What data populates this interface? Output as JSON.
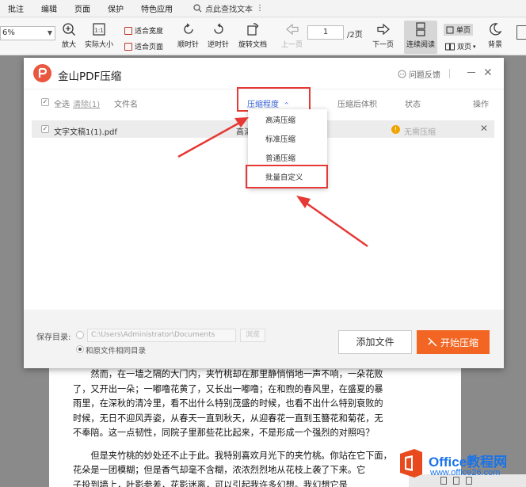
{
  "menubar": {
    "items": [
      "批注",
      "编辑",
      "页面",
      "保护",
      "特色应用"
    ],
    "search_label": "点此查找文本"
  },
  "toolbar": {
    "zoom_value": "6%",
    "zoom_in": "放大",
    "actual_size": "实际大小",
    "fit_width": "适合宽度",
    "fit_page": "适合页面",
    "rotate_cw": "顺时针",
    "rotate_ccw": "逆时针",
    "rotate_doc": "旋转文档",
    "prev_page": "上一页",
    "page_current": "1",
    "page_total": "/2页",
    "next_page": "下一页",
    "continuous": "连续阅读",
    "single": "单页",
    "double": "双页",
    "background": "背景"
  },
  "dialog": {
    "title": "金山PDF压缩",
    "feedback": "问题反馈",
    "columns": {
      "select_all": "全选",
      "clear": "清除(1)",
      "filename": "文件名",
      "level": "压缩程度",
      "after_size": "压缩后体积",
      "status": "状态",
      "action": "操作"
    },
    "file_row": {
      "name": "文字文稿1(1).pdf",
      "level_partial": "高清",
      "status": "无需压缩"
    },
    "dropdown": [
      "高清压缩",
      "标准压缩",
      "普通压缩",
      "批量自定义"
    ],
    "footer": {
      "save_label": "保存目录:",
      "path": "C:\\Users\\Administrator\\Documents",
      "browse": "浏览",
      "same_dir": "和原文件相同目录",
      "add_file": "添加文件",
      "start": "开始压缩"
    }
  },
  "document": {
    "paragraphs": [
      "然而，在一墙之隔的大门内，夹竹桃却在那里静悄悄地一声不响，一朵花败",
      "了，又开出一朵；一嘟噜花黄了，又长出一嘟噜；在和煦的春风里，在盛夏的暴",
      "雨里，在深秋的清冷里，看不出什么特别茂盛的时候，也看不出什么特别衰败的",
      "时候，无日不迎风弄姿，从春天一直到秋天，从迎春花一直到玉簪花和菊花，无",
      "不奉陪。这一点韧性，同院子里那些花比起来，不是形成一个强烈的对照吗？",
      "",
      "但是夹竹桃的妙处还不止于此。我特别喜欢月光下的夹竹桃。你站在它下面，",
      "花朵是一团模糊；但是香气却毫不含糊，浓浓烈烈地从花枝上袭了下来。它",
      "子投到墙上，叶影参差，花影迷离，可以引起我许多幻想。我幻想它是"
    ]
  },
  "watermark": {
    "name": "Office教程网",
    "url": "www.office26.com"
  },
  "colors": {
    "accent_orange": "#f26522",
    "link_blue": "#3a63d6",
    "annotation_red": "#e53935",
    "status_warn": "#f0a400"
  }
}
